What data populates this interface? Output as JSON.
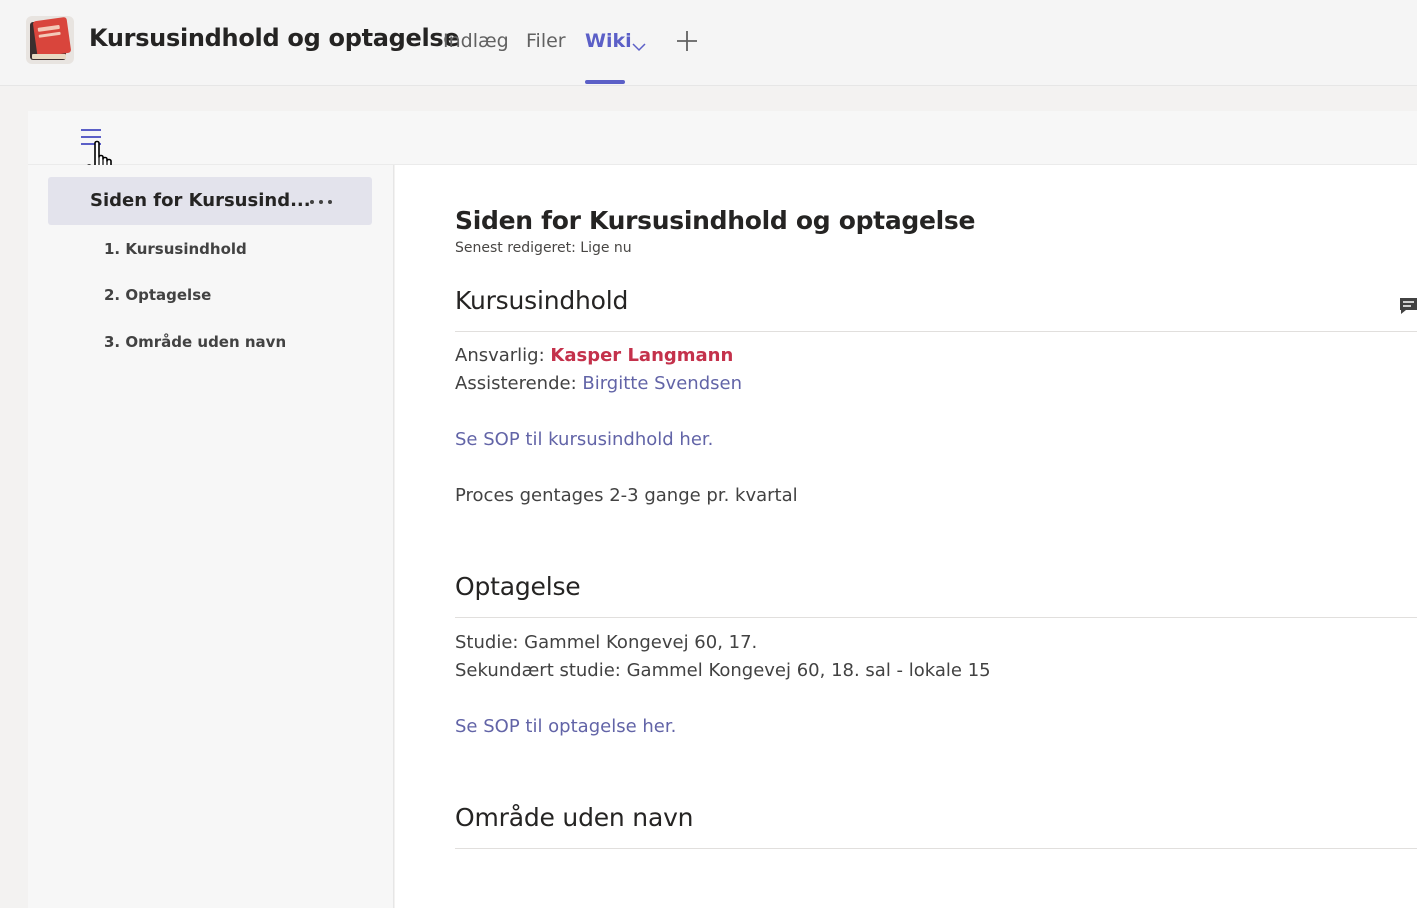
{
  "header": {
    "channel_title": "Kursusindhold og optagelse",
    "tabs": [
      {
        "label": "Indlæg"
      },
      {
        "label": "Filer"
      },
      {
        "label": "Wiki",
        "active": true
      }
    ],
    "accent": "#5b5fc7"
  },
  "sidebar": {
    "page_label": "Siden for Kursusind...",
    "sections": [
      {
        "label": "1. Kursusindhold"
      },
      {
        "label": "2. Optagelse"
      },
      {
        "label": "3. Område uden navn"
      }
    ]
  },
  "content": {
    "page_title": "Siden for Kursusindhold og optagelse",
    "last_edited": "Senest redigeret: Lige nu",
    "sections": [
      {
        "heading": "Kursusindhold",
        "responsible_label": "Ansvarlig: ",
        "responsible_name": "Kasper Langmann",
        "assistant_label": "Assisterende: ",
        "assistant_name": "Birgitte Svendsen",
        "sop_link": "Se SOP til kursusindhold her.",
        "note": "Proces gentages 2-3 gange pr. kvartal"
      },
      {
        "heading": "Optagelse",
        "line1": "Studie: Gammel Kongevej 60, 17.",
        "line2": "Sekundært studie: Gammel Kongevej 60, 18. sal - lokale 15",
        "sop_link": "Se SOP til optagelse her."
      },
      {
        "heading": "Område uden navn"
      }
    ]
  },
  "colors": {
    "link": "#6264a7",
    "mention": "#c4314b"
  }
}
